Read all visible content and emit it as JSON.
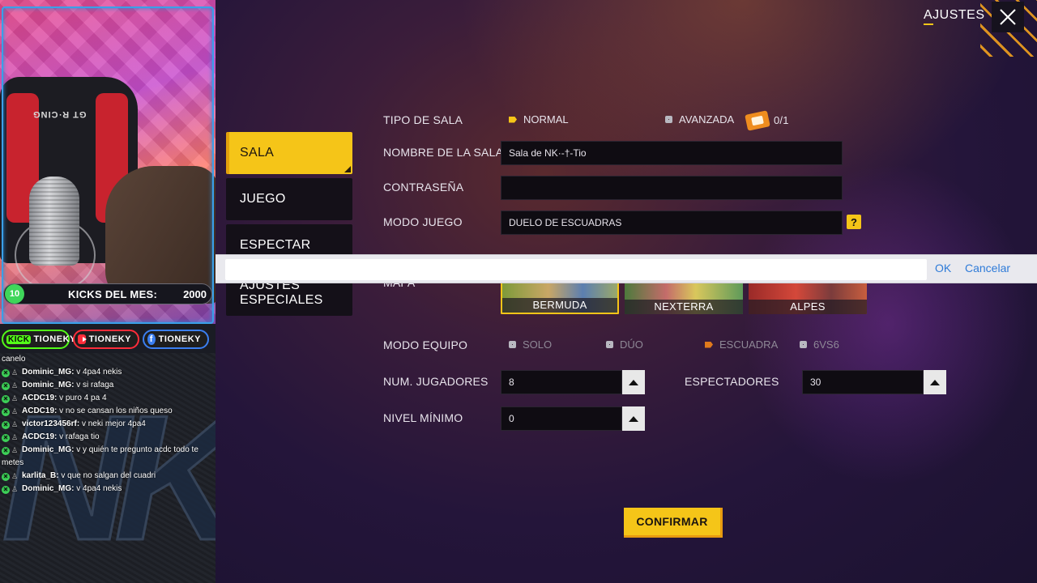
{
  "stream": {
    "kicks_level": "10",
    "kicks_label": "KICKS DEL MES:",
    "kicks_value": "2000",
    "chair_brand": "GT R·CING",
    "socials": [
      {
        "name": "kick",
        "logo": "KICK",
        "handle": "TIONEKY",
        "color": "#53fc18"
      },
      {
        "name": "youtube",
        "handle": "TIONEKY",
        "color": "#ff2d3a"
      },
      {
        "name": "facebook",
        "handle": "TIONEKY",
        "color": "#3b7ff0"
      }
    ],
    "nk_logo_text": "NK",
    "chat": [
      {
        "user": "",
        "text": "canelo"
      },
      {
        "user": "Dominic_MG:",
        "text": "v 4pa4 nekis"
      },
      {
        "user": "Dominic_MG:",
        "text": "v si rafaga"
      },
      {
        "user": "ACDC19:",
        "text": "v puro 4 pa 4"
      },
      {
        "user": "ACDC19:",
        "text": "v no se cansan los niños queso"
      },
      {
        "user": "victor123456rf:",
        "text": "v neki mejor 4pa4"
      },
      {
        "user": "ACDC19:",
        "text": "v rafaga tio"
      },
      {
        "user": "Dominic_MG:",
        "text": "v y quién te pregunto acdc todo te metes"
      },
      {
        "user": "karlita_B:",
        "text": "v que no salgan del cuadri"
      },
      {
        "user": "Dominic_MG:",
        "text": "v 4pa4 nekis"
      }
    ]
  },
  "header": {
    "title": "AJUSTES",
    "close_icon": "close-icon"
  },
  "menu": {
    "items": [
      {
        "label": "SALA",
        "active": true
      },
      {
        "label": "JUEGO",
        "active": false
      },
      {
        "label": "ESPECTAR",
        "active": false
      },
      {
        "label": "AJUSTES ESPECIALES",
        "active": false
      }
    ]
  },
  "form": {
    "room_type_label": "TIPO DE SALA",
    "room_type_normal": "NORMAL",
    "room_type_advanced": "AVANZADA",
    "ticket_count": "0/1",
    "room_name_label": "NOMBRE DE LA SALA",
    "room_name_value": "Sala de NK·-†-Tio",
    "password_label": "CONTRASEÑA",
    "password_value": "",
    "game_mode_label": "MODO JUEGO",
    "game_mode_value": "DUELO DE ESCUADRAS",
    "help_symbol": "?",
    "map_label": "MAPA",
    "maps": [
      "BERMUDA",
      "NEXTERRA",
      "ALPES"
    ],
    "selected_map": "BERMUDA",
    "team_mode_label": "MODO EQUIPO",
    "team_modes": [
      "SOLO",
      "DÚO",
      "ESCUADRA",
      "6VS6"
    ],
    "selected_team_mode": "ESCUADRA",
    "players_label": "NUM. JUGADORES",
    "players_value": "8",
    "spectators_label": "ESPECTADORES",
    "spectators_value": "30",
    "min_level_label": "NIVEL MÍNIMO",
    "min_level_value": "0",
    "confirm_label": "CONFIRMAR"
  },
  "input_bar": {
    "value": "",
    "ok_label": "OK",
    "cancel_label": "Cancelar"
  },
  "colors": {
    "accent": "#f5c518",
    "link": "#2f7bd8"
  }
}
